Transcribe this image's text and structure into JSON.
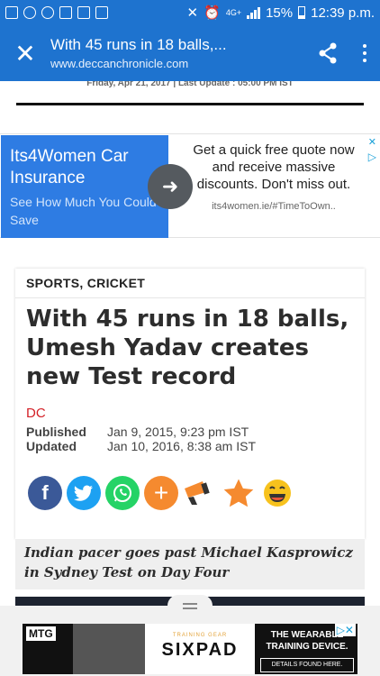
{
  "status_bar": {
    "network": "4G+",
    "battery": "15%",
    "time": "12:39 p.m."
  },
  "toolbar": {
    "title": "With 45 runs in 18 balls,...",
    "url": "www.deccanchronicle.com",
    "close_icon": "close-icon",
    "share_icon": "share-icon",
    "menu_icon": "more-vert-icon"
  },
  "dateline": "Friday, Apr 21, 2017 | Last Update : 05:00 PM IST",
  "ad_top": {
    "title": "Its4Women Car Insurance",
    "subtitle": "See How Much You Could Save",
    "body": "Get a quick free quote now and receive massive discounts. Don't miss out.",
    "link": "its4women.ie/#TimeToOwn..",
    "arrow_icon": "arrow-right-icon"
  },
  "article": {
    "category": "SPORTS, CRICKET",
    "headline": "With 45 runs in 18 balls, Umesh Yadav creates new Test record",
    "author": "DC",
    "published_label": "Published",
    "published_value": "Jan 9, 2015, 9:23 pm IST",
    "updated_label": "Updated",
    "updated_value": "Jan 10, 2016, 8:38 am IST",
    "share_icons": [
      "facebook-icon",
      "twitter-icon",
      "whatsapp-icon",
      "plus-icon",
      "speaker-icon",
      "star-icon",
      "laugh-emoji-icon"
    ],
    "subheadline": "Indian pacer goes past Michael Kasprowicz in Sydney Test on Day Four"
  },
  "ad_bottom": {
    "brand_tag": "MTG",
    "training_gear": "TRAINING GEAR",
    "product": "SIXPAD",
    "headline": "THE WEARABLE TRAINING DEVICE.",
    "cta": "DETAILS FOUND HERE."
  },
  "colors": {
    "toolbar_blue": "#1e73cf",
    "author_red": "#d31f26",
    "ad_blue": "#2e7ce3"
  }
}
